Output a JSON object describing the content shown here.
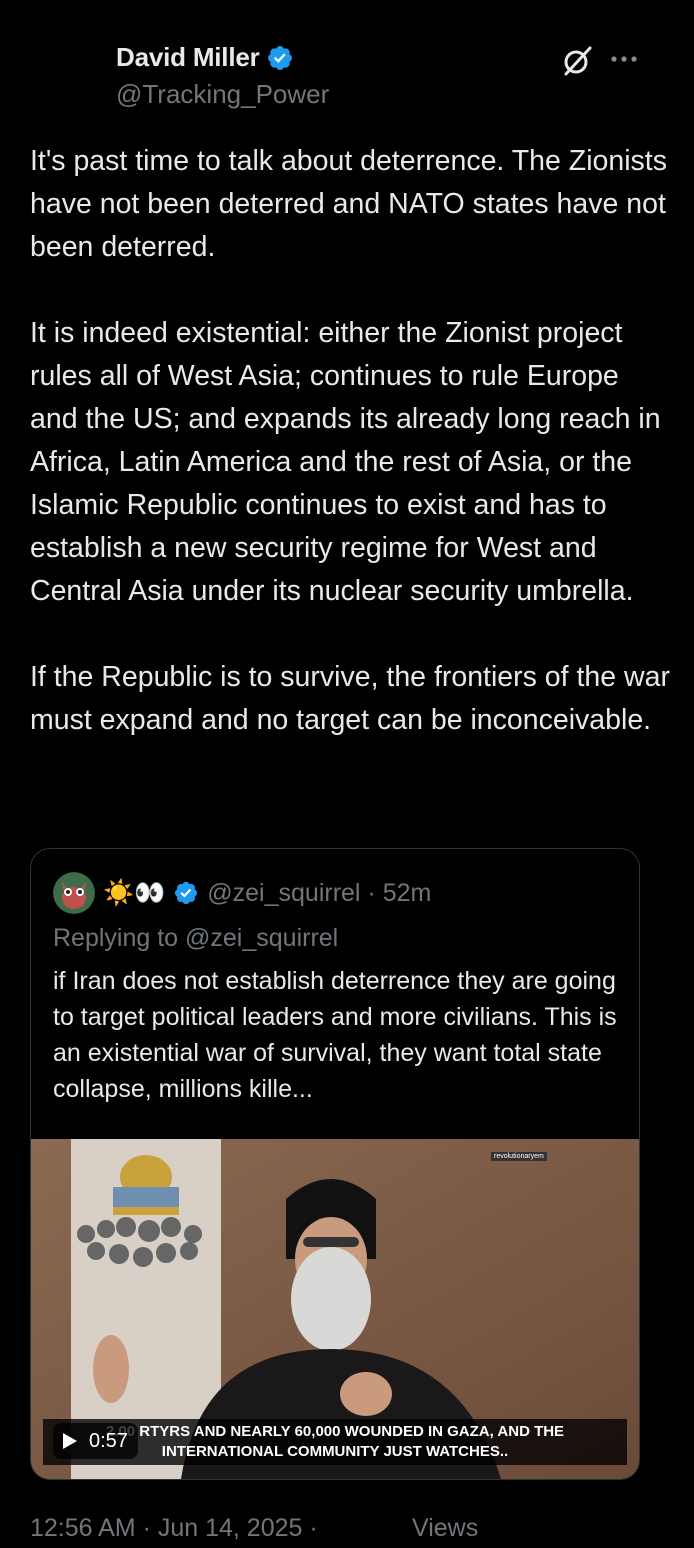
{
  "author": {
    "display_name": "David Miller",
    "handle": "@Tracking_Power",
    "verified_color": "#1d9bf0"
  },
  "icons": {
    "grok": "grok-icon",
    "more": "more-icon",
    "verified": "verified-badge-icon",
    "play": "play-icon"
  },
  "tweet": {
    "text": "It's past time to talk about deterrence. The Zionists have not been deterred and NATO states have not been deterred.\n\nIt is indeed existential: either the Zionist project rules all of West Asia; continues to rule Europe and the US; and expands its already long reach in Africa, Latin America and the rest of Asia, or the Islamic Republic continues to exist and has to establish a new security regime for West and Central Asia under its nuclear security umbrella.\n\nIf the Republic is to survive, the frontiers of the war must expand and no target can be inconceivable."
  },
  "quote": {
    "display_name": "☀️👀",
    "handle_time": "@zei_squirrel · 52m",
    "replying_to": "Replying to @zei_squirrel",
    "text": "if Iran does not establish deterrence they are going to target political leaders and more civilians. This is an existential war of survival, they want total state collapse, millions kille...",
    "media": {
      "watermark": "revolutionaryem",
      "caption_line1": "2.00    RTYRS AND NEARLY 60,000 WOUNDED IN GAZA, AND THE",
      "caption_line2": "INTERNATIONAL COMMUNITY JUST WATCHES..",
      "duration": "0:57"
    }
  },
  "footer": {
    "timestamp": "12:56 AM · Jun 14, 2025 ·",
    "views_label": "Views"
  }
}
